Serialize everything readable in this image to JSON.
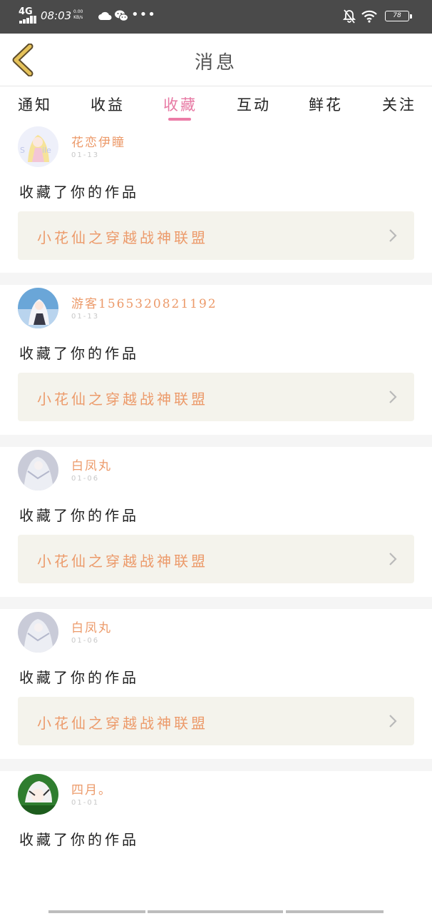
{
  "status_bar": {
    "network": "4G",
    "time": "08:03",
    "speed_value": "0.00",
    "speed_unit": "KB/s",
    "battery_level": "78",
    "icons": [
      "cloud-icon",
      "wechat-icon",
      "more-dots-icon",
      "bell-off-icon",
      "wifi-icon",
      "battery-icon"
    ]
  },
  "header": {
    "title": "消息",
    "back_icon": "chevron-left-icon",
    "back_color": "#e5c25a"
  },
  "tabs": [
    {
      "label": "通知",
      "active": false
    },
    {
      "label": "收益",
      "active": false
    },
    {
      "label": "收藏",
      "active": true
    },
    {
      "label": "互动",
      "active": false
    },
    {
      "label": "鲜花",
      "active": false
    },
    {
      "label": "关注",
      "active": false
    }
  ],
  "colors": {
    "accent": "#e779a3",
    "name": "#ec9a6a",
    "work_bg": "#f4f3ec",
    "separator": "#f5f5f5"
  },
  "messages": [
    {
      "user": "花恋伊瞳",
      "date": "01-13",
      "action": "收藏了你的作品",
      "work": "小花仙之穿越战神联盟"
    },
    {
      "user": "游客1565320821192",
      "date": "01-13",
      "action": "收藏了你的作品",
      "work": "小花仙之穿越战神联盟"
    },
    {
      "user": "白凤丸",
      "date": "01-06",
      "action": "收藏了你的作品",
      "work": "小花仙之穿越战神联盟"
    },
    {
      "user": "白凤丸",
      "date": "01-06",
      "action": "收藏了你的作品",
      "work": "小花仙之穿越战神联盟"
    },
    {
      "user": "四月。",
      "date": "01-01",
      "action": "收藏了你的作品",
      "work": "小花仙之穿越战神联盟"
    }
  ]
}
